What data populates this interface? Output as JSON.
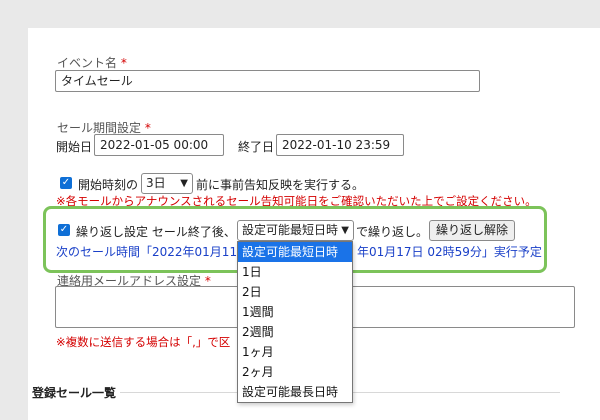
{
  "event_name": {
    "label": "イベント名",
    "required": "*",
    "value": "タイムセール"
  },
  "sale_period": {
    "label": "セール期間設定",
    "required": "*",
    "start_label": "開始日",
    "start_value": "2022-01-05 00:00",
    "end_label": "終了日",
    "end_value": "2022-01-10 23:59"
  },
  "pre_notice": {
    "text_before": "開始時刻の",
    "select_value": "3日",
    "text_after": "前に事前告知反映を実行する。",
    "warning": "※各モールからアナウンスされるセール告知可能日をご確認いただいた上でご設定ください。"
  },
  "repeat": {
    "label": "繰り返し設定 セール終了後、",
    "select_value": "設定可能最短日時",
    "text_after": "で繰り返し。",
    "cancel_button": "繰り返し解除",
    "next_prefix": "次のセール時間「2022年01月11日",
    "next_suffix": "年01月17日 02時59分」実行予定"
  },
  "dropdown_options": [
    "設定可能最短日時",
    "1日",
    "2日",
    "1週間",
    "2週間",
    "1ヶ月",
    "2ヶ月",
    "設定可能最長日時"
  ],
  "selected_option_index": 0,
  "email": {
    "label": "連絡用メールアドレス設定",
    "required": "*",
    "value": "",
    "note_prefix": "※複数に送信する場合は「,」で区"
  },
  "registered_sales": {
    "heading": "登録セール一覧"
  },
  "colors": {
    "highlight": "#7cc35a",
    "accent": "#1a73e8",
    "warning": "#d40000",
    "link": "#1a40c8"
  }
}
